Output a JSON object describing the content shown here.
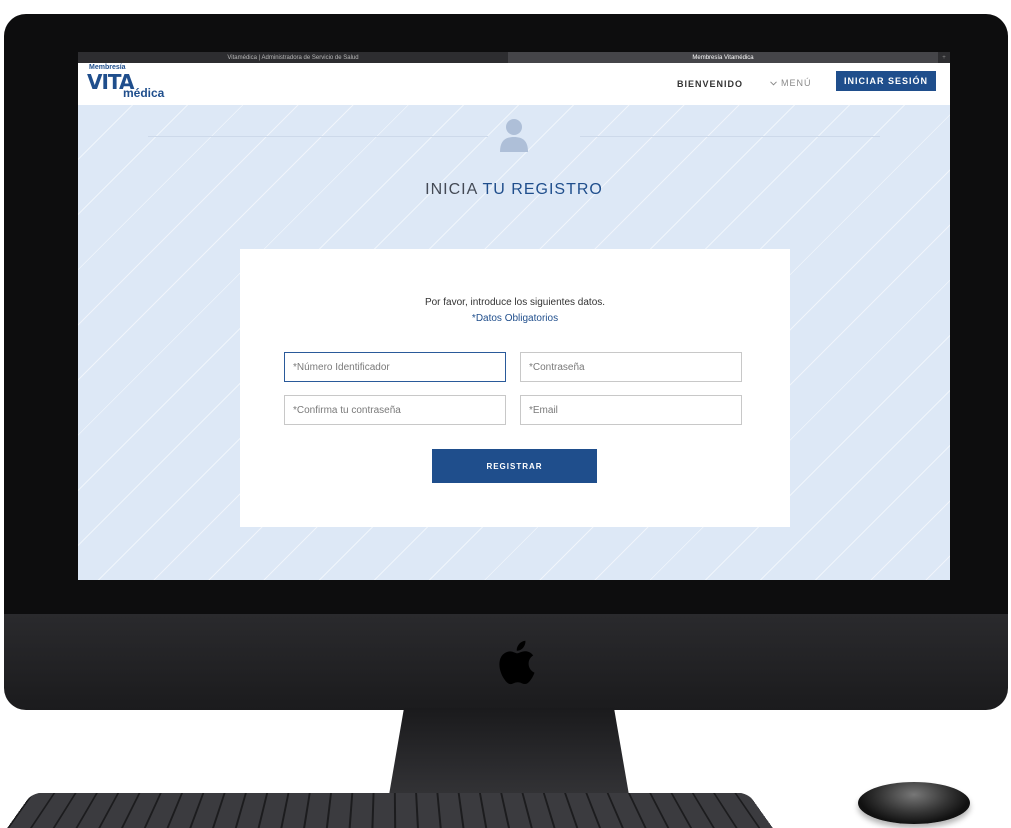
{
  "browser": {
    "tabs": [
      {
        "title": "Vitamédica | Administradora de Servicio de Salud"
      },
      {
        "title": "Membresía Vitamédica"
      }
    ],
    "new_tab_symbol": "+"
  },
  "header": {
    "logo_top": "Membresía",
    "logo_main": "VITA",
    "logo_sub": "médica",
    "nav_welcome": "BIENVENIDO",
    "nav_menu": "MENÚ",
    "login_button": "INICIAR SESIÓN"
  },
  "hero": {
    "icon": "user-icon",
    "title_part1": "INICIA ",
    "title_part2": "TU REGISTRO"
  },
  "form": {
    "instructions": "Por favor, introduce los siguientes datos.",
    "required_note": "*Datos Obligatorios",
    "fields": {
      "id_number": {
        "placeholder": "*Número Identificador",
        "value": ""
      },
      "password": {
        "placeholder": "*Contraseña",
        "value": ""
      },
      "confirm_password": {
        "placeholder": "*Confirma tu contraseña",
        "value": ""
      },
      "email": {
        "placeholder": "*Email",
        "value": ""
      }
    },
    "submit_button": "REGISTRAR"
  },
  "colors": {
    "brand": "#1f4e8c",
    "background": "#dde8f6",
    "device": "#0d0d0e"
  }
}
